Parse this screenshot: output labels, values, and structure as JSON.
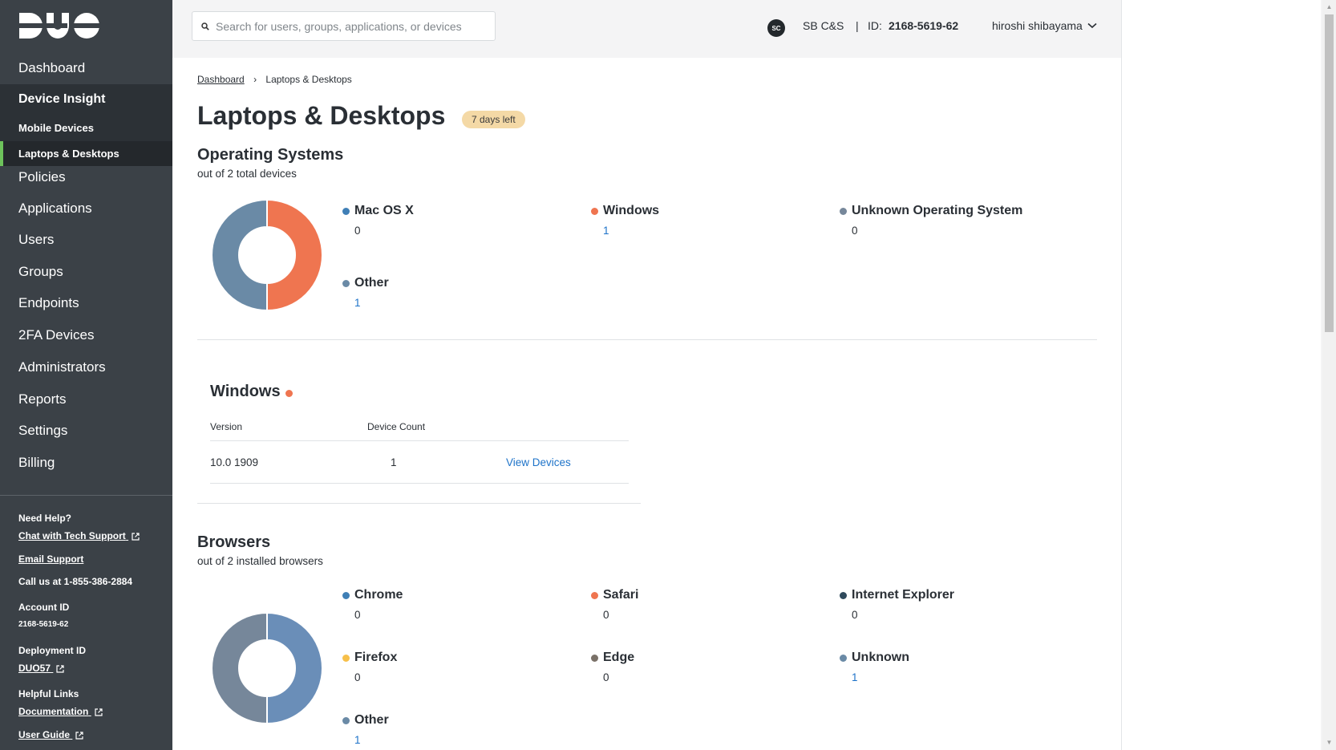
{
  "brand": {
    "logo": "DUO"
  },
  "search": {
    "placeholder": "Search for users, groups, applications, or devices"
  },
  "account": {
    "avatar_initials": "SC",
    "org": "SB C&S",
    "separator": "|",
    "id_label": "ID:",
    "id_value": "2168-5619-62",
    "user": "hiroshi shibayama"
  },
  "sidebar": {
    "items": [
      {
        "label": "Dashboard"
      },
      {
        "label": "Policies"
      },
      {
        "label": "Applications"
      },
      {
        "label": "Users"
      },
      {
        "label": "Groups"
      },
      {
        "label": "Endpoints"
      },
      {
        "label": "2FA Devices"
      },
      {
        "label": "Administrators"
      },
      {
        "label": "Reports"
      },
      {
        "label": "Settings"
      },
      {
        "label": "Billing"
      }
    ],
    "group": {
      "title": "Device Insight",
      "subitems": [
        {
          "label": "Mobile Devices"
        },
        {
          "label": "Laptops & Desktops"
        }
      ]
    },
    "help": {
      "need_help": "Need Help?",
      "chat": "Chat with Tech Support",
      "email": "Email Support",
      "call": "Call us at 1-855-386-2884",
      "account_id_label": "Account ID",
      "account_id": "2168-5619-62",
      "deployment_id_label": "Deployment ID",
      "deployment_id": "DUO57",
      "helpful_links": "Helpful Links",
      "documentation": "Documentation",
      "user_guide": "User Guide"
    }
  },
  "breadcrumb": {
    "root": "Dashboard",
    "current": "Laptops & Desktops"
  },
  "page": {
    "title": "Laptops & Desktops",
    "badge": "7 days left"
  },
  "os": {
    "title": "Operating Systems",
    "subtitle": "out of 2 total devices",
    "legend": [
      {
        "label": "Mac OS X",
        "value": "0",
        "color": "#3f7fb6"
      },
      {
        "label": "Windows",
        "value": "1",
        "color": "#ef7550"
      },
      {
        "label": "Unknown Operating System",
        "value": "0",
        "color": "#76879a"
      },
      {
        "label": "Other",
        "value": "1",
        "color": "#6a8aa6"
      }
    ]
  },
  "windows": {
    "title": "Windows",
    "headers": {
      "version": "Version",
      "count": "Device Count"
    },
    "row": {
      "version": "10.0 1909",
      "count": "1",
      "action": "View Devices"
    }
  },
  "browsers": {
    "title": "Browsers",
    "subtitle": "out of 2 installed browsers",
    "legend": [
      {
        "label": "Chrome",
        "value": "0",
        "color": "#3f7fb6"
      },
      {
        "label": "Safari",
        "value": "0",
        "color": "#ef7550"
      },
      {
        "label": "Internet Explorer",
        "value": "0",
        "color": "#2f4a5c"
      },
      {
        "label": "Firefox",
        "value": "0",
        "color": "#f7c04a"
      },
      {
        "label": "Edge",
        "value": "0",
        "color": "#7a7168"
      },
      {
        "label": "Unknown",
        "value": "1",
        "color": "#6a8aa6"
      },
      {
        "label": "Other",
        "value": "1",
        "color": "#6a8aa6"
      }
    ]
  },
  "chart_data": [
    {
      "type": "pie",
      "categories": [
        "Mac OS X",
        "Windows",
        "Unknown Operating System",
        "Other"
      ],
      "values": [
        0,
        1,
        0,
        1
      ]
    },
    {
      "type": "pie",
      "categories": [
        "Chrome",
        "Safari",
        "Internet Explorer",
        "Firefox",
        "Edge",
        "Unknown",
        "Other"
      ],
      "values": [
        0,
        0,
        0,
        0,
        0,
        1,
        1
      ]
    }
  ]
}
